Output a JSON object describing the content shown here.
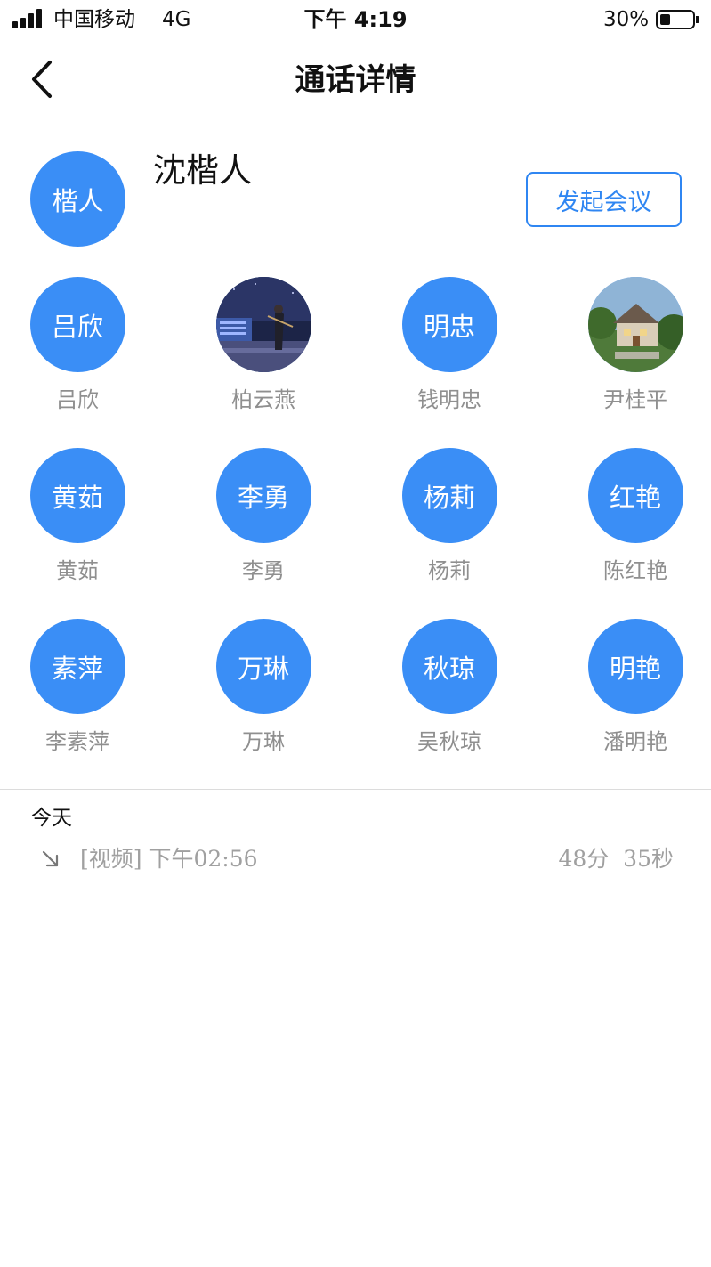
{
  "status_bar": {
    "carrier": "中国移动",
    "network": "4G",
    "time": "下午 4:19",
    "battery": "30%",
    "battery_level": 0.3
  },
  "nav": {
    "back_icon": "chevron-left-icon",
    "title": "通话详情"
  },
  "host": {
    "avatar_text": "楷人",
    "name": "沈楷人",
    "start_meeting_label": "发起会议",
    "accent_color": "#3a8ef6"
  },
  "participants": [
    {
      "avatar_text": "吕欣",
      "name": "吕欣"
    },
    {
      "avatar_text": "",
      "name": "柏云燕",
      "photo": "violinist-night-photo"
    },
    {
      "avatar_text": "明忠",
      "name": "钱明忠"
    },
    {
      "avatar_text": "",
      "name": "尹桂平",
      "photo": "house-photo"
    },
    {
      "avatar_text": "黄茹",
      "name": "黄茹"
    },
    {
      "avatar_text": "李勇",
      "name": "李勇"
    },
    {
      "avatar_text": "杨莉",
      "name": "杨莉"
    },
    {
      "avatar_text": "红艳",
      "name": "陈红艳"
    },
    {
      "avatar_text": "素萍",
      "name": "李素萍"
    },
    {
      "avatar_text": "万琳",
      "name": "万琳"
    },
    {
      "avatar_text": "秋琼",
      "name": "吴秋琼"
    },
    {
      "avatar_text": "明艳",
      "name": "潘明艳"
    }
  ],
  "history": {
    "day_label": "今天",
    "records": [
      {
        "direction_icon": "incoming-arrow-icon",
        "text": "[视频] 下午02:56",
        "duration": "48分  35秒"
      }
    ]
  }
}
